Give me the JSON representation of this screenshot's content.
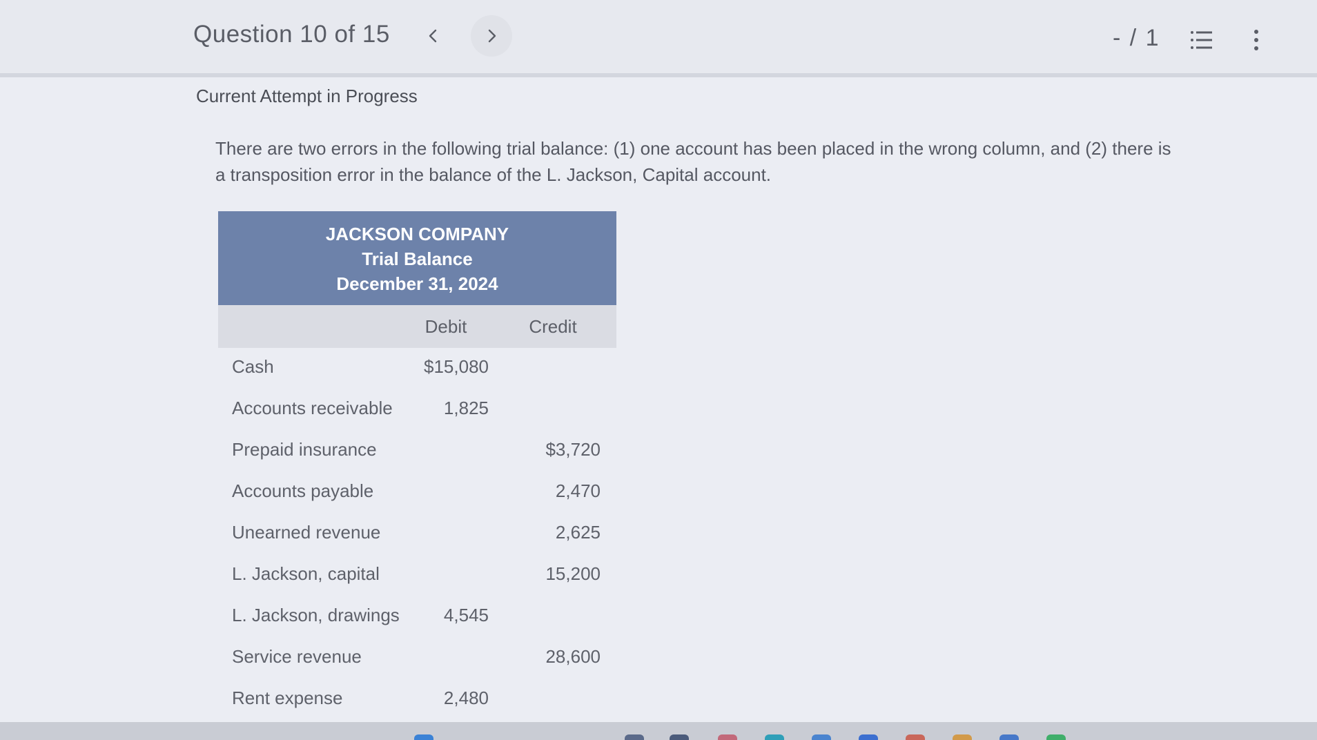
{
  "header": {
    "question_label": "Question 10 of 15",
    "score": "- / 1"
  },
  "icons": {
    "prev": "chevron-left-icon",
    "next": "chevron-right-icon",
    "list": "question-list-icon",
    "more": "more-vertical-icon"
  },
  "attempt_status": "Current Attempt in Progress",
  "question_text": "There are two errors in the following trial balance: (1) one account has been placed in the wrong column, and (2) there is a transposition error in the balance of the L. Jackson, Capital account.",
  "trial_balance": {
    "company": "JACKSON COMPANY",
    "statement": "Trial Balance",
    "date": "December 31, 2024",
    "col_debit": "Debit",
    "col_credit": "Credit",
    "rows": [
      {
        "account": "Cash",
        "debit": "$15,080",
        "credit": ""
      },
      {
        "account": "Accounts receivable",
        "debit": "1,825",
        "credit": ""
      },
      {
        "account": "Prepaid insurance",
        "debit": "",
        "credit": "$3,720"
      },
      {
        "account": "Accounts payable",
        "debit": "",
        "credit": "2,470"
      },
      {
        "account": "Unearned revenue",
        "debit": "",
        "credit": "2,625"
      },
      {
        "account": "L. Jackson, capital",
        "debit": "",
        "credit": "15,200"
      },
      {
        "account": "L. Jackson, drawings",
        "debit": "4,545",
        "credit": ""
      },
      {
        "account": "Service revenue",
        "debit": "",
        "credit": "28,600"
      },
      {
        "account": "Rent expense",
        "debit": "2,480",
        "credit": ""
      }
    ]
  },
  "colors": {
    "table_header_bg": "#6d82aa",
    "column_header_bg": "#dadce3",
    "page_bg": "#ebedf3"
  }
}
